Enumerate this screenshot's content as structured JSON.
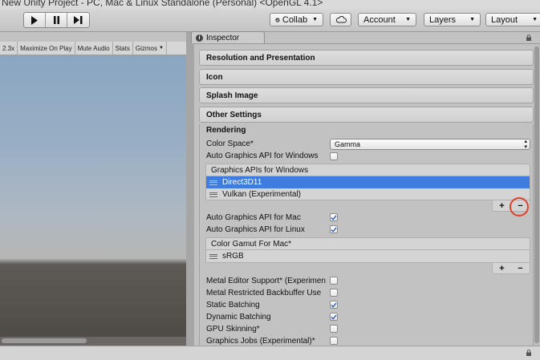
{
  "window": {
    "title": "New Unity Project - PC, Mac & Linux Standalone (Personal) <OpenGL 4.1>"
  },
  "toolbar": {
    "collab_label": "Collab",
    "account_label": "Account",
    "layers_label": "Layers",
    "layout_label": "Layout"
  },
  "game_view": {
    "scale": "2.3x",
    "maximize_on_play": "Maximize On Play",
    "mute_audio": "Mute Audio",
    "stats": "Stats",
    "gizmos": "Gizmos"
  },
  "inspector": {
    "tab_label": "Inspector",
    "sections": {
      "resolution": "Resolution and Presentation",
      "icon": "Icon",
      "splash": "Splash Image",
      "other": "Other Settings"
    },
    "rendering_label": "Rendering",
    "color_space": {
      "label": "Color Space*",
      "value": "Gamma"
    },
    "auto_graphics_windows": {
      "label": "Auto Graphics API for Windows",
      "checked": false
    },
    "graphics_apis_windows": {
      "header": "Graphics APIs for Windows",
      "items": [
        "Direct3D11",
        "Vulkan (Experimental)"
      ]
    },
    "auto_graphics_mac": {
      "label": "Auto Graphics API for Mac",
      "checked": true
    },
    "auto_graphics_linux": {
      "label": "Auto Graphics API for Linux",
      "checked": true
    },
    "color_gamut_mac": {
      "header": "Color Gamut For Mac*",
      "items": [
        "sRGB"
      ]
    },
    "metal_editor_support": {
      "label": "Metal Editor Support* (Experimen",
      "checked": false
    },
    "metal_restricted_backbuffer": {
      "label": "Metal Restricted Backbuffer Use",
      "checked": false
    },
    "static_batching": {
      "label": "Static Batching",
      "checked": true
    },
    "dynamic_batching": {
      "label": "Dynamic Batching",
      "checked": true
    },
    "gpu_skinning": {
      "label": "GPU Skinning*",
      "checked": false
    },
    "graphics_jobs": {
      "label": "Graphics Jobs (Experimental)*",
      "checked": false
    },
    "plus": "+",
    "minus": "−"
  },
  "colors": {
    "selection": "#3e7ce0",
    "annotation_circle": "#e0402a",
    "checkmark": "#2f5fb8"
  }
}
